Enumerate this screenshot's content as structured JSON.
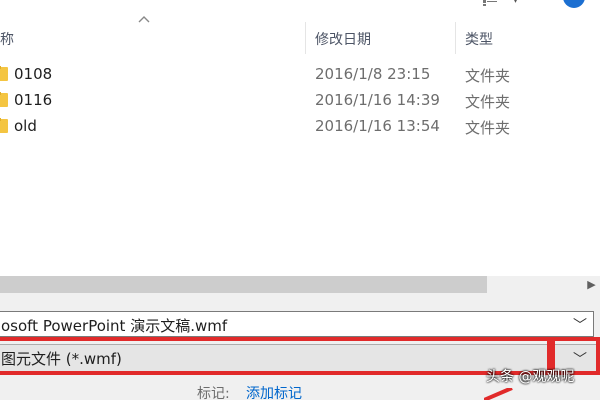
{
  "header": {
    "col_name": "称",
    "col_date": "修改日期",
    "col_type": "类型"
  },
  "files": [
    {
      "name": "0108",
      "date": "2016/1/8 23:15",
      "type": "文件夹"
    },
    {
      "name": "0116",
      "date": "2016/1/16 14:39",
      "type": "文件夹"
    },
    {
      "name": "old",
      "date": "2016/1/16 13:54",
      "type": "文件夹"
    }
  ],
  "save_form": {
    "filename_value": "osoft PowerPoint 演示文稿.wmf",
    "filetype_value": "图元文件 (*.wmf)",
    "tags_label": "标记:",
    "tags_link": "添加标记"
  },
  "watermark": "头条 @观观呢",
  "colors": {
    "accent": "#1c6fd1",
    "highlight_red": "#e12a2a",
    "link_blue": "#0066cc",
    "folder_yellow": "#f4c542"
  },
  "icons": [
    "view-options-icon",
    "help-icon",
    "sort-up-icon",
    "folder-icon",
    "chevron-down-icon",
    "scroll-right-icon"
  ]
}
